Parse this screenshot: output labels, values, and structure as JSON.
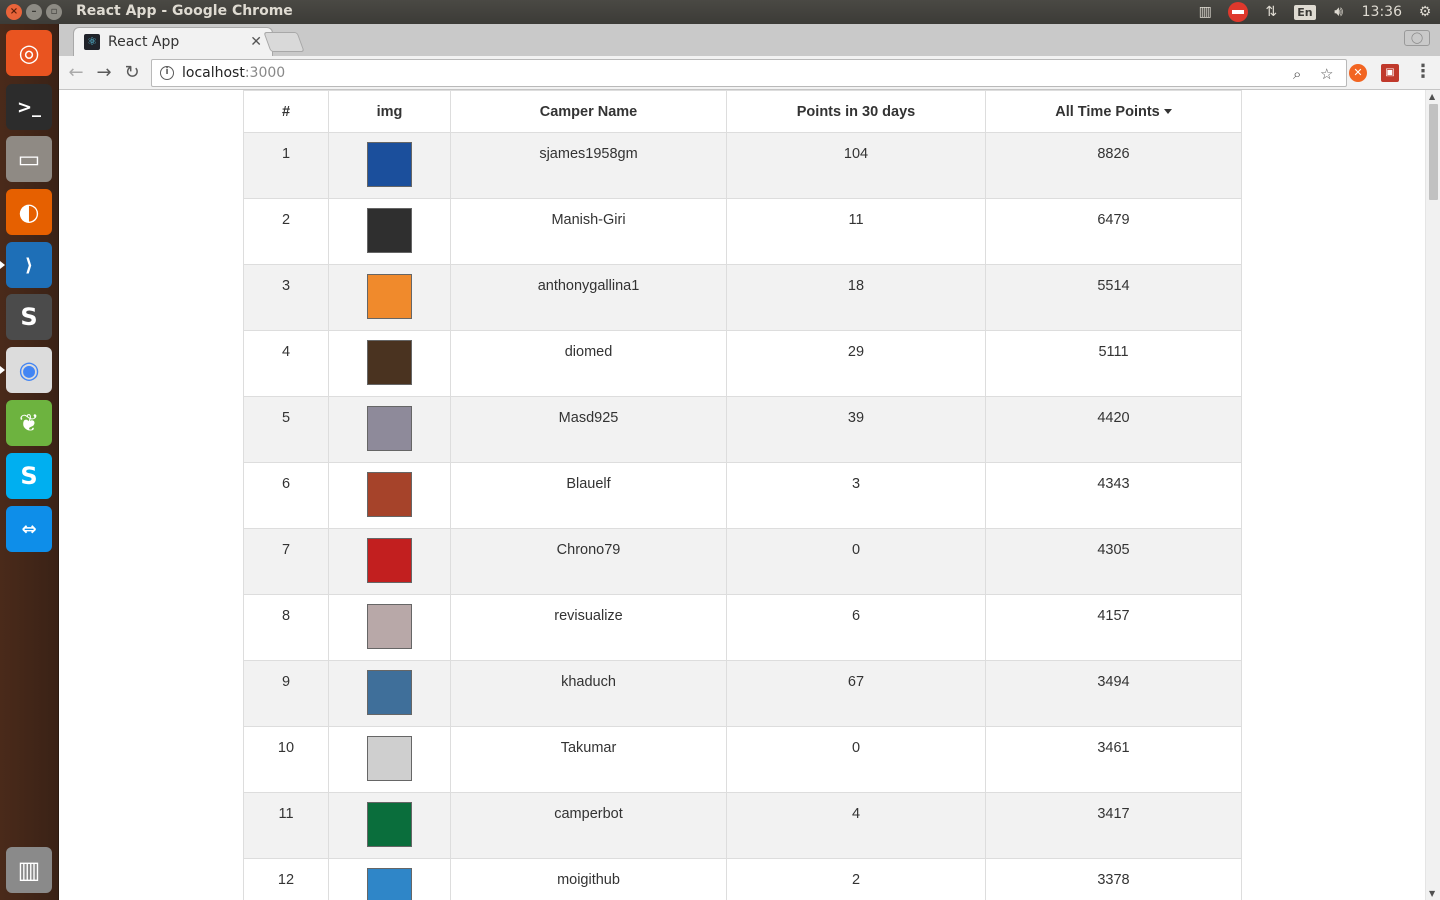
{
  "os": {
    "window_title": "React App - Google Chrome",
    "clock": "13:36",
    "keyboard_layout": "En"
  },
  "launcher": {
    "apps": [
      {
        "name": "ubuntu-dash-icon",
        "color": "#e95420",
        "glyph": "◎"
      },
      {
        "name": "terminal-icon",
        "color": "#2c2c2c",
        "glyph": ">_"
      },
      {
        "name": "files-icon",
        "color": "#8f8a84",
        "glyph": "▭"
      },
      {
        "name": "firefox-icon",
        "color": "#e66000",
        "glyph": "◐"
      },
      {
        "name": "vscode-icon",
        "color": "#1e6fb7",
        "glyph": "⟩"
      },
      {
        "name": "sublime-text-icon",
        "color": "#4b4b4b",
        "glyph": "S"
      },
      {
        "name": "chrome-icon",
        "color": "#dcdcdc",
        "glyph": "◉"
      },
      {
        "name": "spring-tool-suite-icon",
        "color": "#6db33f",
        "glyph": "❦"
      },
      {
        "name": "skype-icon",
        "color": "#00aff0",
        "glyph": "S"
      },
      {
        "name": "teamviewer-icon",
        "color": "#0e8ee9",
        "glyph": "⇔"
      },
      {
        "name": "trash-icon",
        "color": "#8a8a8a",
        "glyph": "▥"
      }
    ]
  },
  "browser": {
    "tab_title": "React App",
    "url_host": "localhost",
    "url_port": ":3000"
  },
  "leaderboard": {
    "headers": {
      "rank": "#",
      "img": "img",
      "name": "Camper Name",
      "recent": "Points in 30 days",
      "alltime": "All Time Points"
    },
    "rows": [
      {
        "rank": "1",
        "name": "sjames1958gm",
        "recent": "104",
        "alltime": "8826",
        "avatar_color": "#1b4f9c"
      },
      {
        "rank": "2",
        "name": "Manish-Giri",
        "recent": "11",
        "alltime": "6479",
        "avatar_color": "#2f2f2f"
      },
      {
        "rank": "3",
        "name": "anthonygallina1",
        "recent": "18",
        "alltime": "5514",
        "avatar_color": "#f08a2c"
      },
      {
        "rank": "4",
        "name": "diomed",
        "recent": "29",
        "alltime": "5111",
        "avatar_color": "#4a3320"
      },
      {
        "rank": "5",
        "name": "Masd925",
        "recent": "39",
        "alltime": "4420",
        "avatar_color": "#8e8a9a"
      },
      {
        "rank": "6",
        "name": "Blauelf",
        "recent": "3",
        "alltime": "4343",
        "avatar_color": "#a6432a"
      },
      {
        "rank": "7",
        "name": "Chrono79",
        "recent": "0",
        "alltime": "4305",
        "avatar_color": "#c21f1f"
      },
      {
        "rank": "8",
        "name": "revisualize",
        "recent": "6",
        "alltime": "4157",
        "avatar_color": "#b8a8a8"
      },
      {
        "rank": "9",
        "name": "khaduch",
        "recent": "67",
        "alltime": "3494",
        "avatar_color": "#3f6f9a"
      },
      {
        "rank": "10",
        "name": "Takumar",
        "recent": "0",
        "alltime": "3461",
        "avatar_color": "#cfcfcf"
      },
      {
        "rank": "11",
        "name": "camperbot",
        "recent": "4",
        "alltime": "3417",
        "avatar_color": "#0a6e3c"
      },
      {
        "rank": "12",
        "name": "moigithub",
        "recent": "2",
        "alltime": "3378",
        "avatar_color": "#2f86c8"
      }
    ]
  }
}
